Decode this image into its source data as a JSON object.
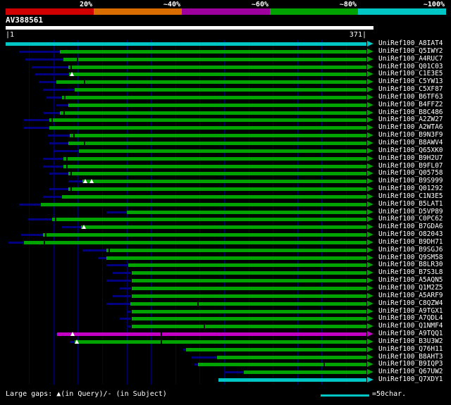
{
  "colors": {
    "green": "#00a300",
    "cyan": "#00c6c6",
    "magenta": "#c400c4",
    "navy": "#000080",
    "tick": "#001400",
    "grid": "#00005e",
    "query_bar": "#ffffff"
  },
  "chart_data": {
    "type": "alignment-overview",
    "title": "AV388561",
    "query": {
      "name": "AV388561",
      "length": 371,
      "start_label": "|1",
      "end_label": "371|"
    },
    "color_key": {
      "segments": [
        {
          "label": "20%",
          "color": "#d10000"
        },
        {
          "label": "~40%",
          "color": "#d96d00"
        },
        {
          "label": "~60%",
          "color": "#9d009d"
        },
        {
          "label": "~80%",
          "color": "#00a300"
        },
        {
          "label": "~100%",
          "color": "#00c6c6"
        }
      ]
    },
    "legend": {
      "gaps_text": "Large gaps: ▲(in Query)/- (in Subject)",
      "scale_text": "=50char.",
      "scale_chars": 50
    },
    "alignments": [
      {
        "label": "UniRef100_A8IAT4",
        "color": "cyan",
        "subject_start": 1,
        "align_start": 1,
        "align_end": 371,
        "ticks": [],
        "gaps": []
      },
      {
        "label": "UniRef100_Q5IWY2",
        "color": "green",
        "subject_start": 15,
        "align_start": 57,
        "align_end": 371,
        "ticks": [],
        "gaps": []
      },
      {
        "label": "UniRef100_A4RUC7",
        "color": "green",
        "subject_start": 21,
        "align_start": 60,
        "align_end": 371,
        "ticks": [
          75
        ],
        "gaps": []
      },
      {
        "label": "UniRef100_Q01C03",
        "color": "green",
        "subject_start": 28,
        "align_start": 65,
        "align_end": 371,
        "ticks": [
          68
        ],
        "gaps": []
      },
      {
        "label": "UniRef100_C1E3E5",
        "color": "green",
        "subject_start": 31,
        "align_start": 66,
        "align_end": 371,
        "ticks": [],
        "gaps": [
          69
        ]
      },
      {
        "label": "UniRef100_C5YW13",
        "color": "green",
        "subject_start": 35,
        "align_start": 53,
        "align_end": 371,
        "ticks": [
          82
        ],
        "gaps": []
      },
      {
        "label": "UniRef100_C5XF87",
        "color": "green",
        "subject_start": 39,
        "align_start": 72,
        "align_end": 371,
        "ticks": [],
        "gaps": []
      },
      {
        "label": "UniRef100_B6TF63",
        "color": "green",
        "subject_start": 43,
        "align_start": 59,
        "align_end": 371,
        "ticks": [
          62
        ],
        "gaps": []
      },
      {
        "label": "UniRef100_B4FFZ2",
        "color": "green",
        "subject_start": 53,
        "align_start": 65,
        "align_end": 371,
        "ticks": [],
        "gaps": []
      },
      {
        "label": "UniRef100_B8C486",
        "color": "green",
        "subject_start": 40,
        "align_start": 57,
        "align_end": 371,
        "ticks": [
          61
        ],
        "gaps": []
      },
      {
        "label": "UniRef100_A2ZW27",
        "color": "green",
        "subject_start": 20,
        "align_start": 46,
        "align_end": 371,
        "ticks": [
          49
        ],
        "gaps": []
      },
      {
        "label": "UniRef100_A2WTA6",
        "color": "green",
        "subject_start": 20,
        "align_start": 46,
        "align_end": 371,
        "ticks": [],
        "gaps": []
      },
      {
        "label": "UniRef100_B9N3F9",
        "color": "green",
        "subject_start": 44,
        "align_start": 67,
        "align_end": 371,
        "ticks": [
          71
        ],
        "gaps": []
      },
      {
        "label": "UniRef100_B8AWV4",
        "color": "green",
        "subject_start": 46,
        "align_start": 65,
        "align_end": 371,
        "ticks": [
          82
        ],
        "gaps": []
      },
      {
        "label": "UniRef100_Q65XK0",
        "color": "green",
        "subject_start": 50,
        "align_start": 76,
        "align_end": 371,
        "ticks": [],
        "gaps": []
      },
      {
        "label": "UniRef100_B9H2U7",
        "color": "green",
        "subject_start": 39,
        "align_start": 60,
        "align_end": 371,
        "ticks": [
          64
        ],
        "gaps": []
      },
      {
        "label": "UniRef100_B9FL07",
        "color": "green",
        "subject_start": 39,
        "align_start": 60,
        "align_end": 371,
        "ticks": [
          64
        ],
        "gaps": []
      },
      {
        "label": "UniRef100_Q05758",
        "color": "green",
        "subject_start": 46,
        "align_start": 65,
        "align_end": 371,
        "ticks": [
          68
        ],
        "gaps": []
      },
      {
        "label": "UniRef100_B9S999",
        "color": "green",
        "subject_start": 65,
        "align_start": 80,
        "align_end": 371,
        "ticks": [],
        "gaps": [
          83,
          89
        ]
      },
      {
        "label": "UniRef100_Q01292",
        "color": "green",
        "subject_start": 46,
        "align_start": 65,
        "align_end": 371,
        "ticks": [
          68
        ],
        "gaps": []
      },
      {
        "label": "UniRef100_C1N3E5",
        "color": "green",
        "subject_start": 39,
        "align_start": 59,
        "align_end": 371,
        "ticks": [],
        "gaps": []
      },
      {
        "label": "UniRef100_B5LAT1",
        "color": "green",
        "subject_start": 15,
        "align_start": 37,
        "align_end": 371,
        "ticks": [],
        "gaps": []
      },
      {
        "label": "UniRef100_D5VP89",
        "color": "green",
        "subject_start": 104,
        "align_start": 125,
        "align_end": 371,
        "ticks": [],
        "gaps": []
      },
      {
        "label": "UniRef100_C0PC62",
        "color": "green",
        "subject_start": 24,
        "align_start": 49,
        "align_end": 371,
        "ticks": [
          52
        ],
        "gaps": []
      },
      {
        "label": "UniRef100_B7GDA6",
        "color": "green",
        "subject_start": 59,
        "align_start": 78,
        "align_end": 371,
        "ticks": [],
        "gaps": [
          81
        ]
      },
      {
        "label": "UniRef100_O82043",
        "color": "green",
        "subject_start": 17,
        "align_start": 39,
        "align_end": 371,
        "ticks": [
          42
        ],
        "gaps": []
      },
      {
        "label": "UniRef100_B9DH71",
        "color": "green",
        "subject_start": 4,
        "align_start": 20,
        "align_end": 371,
        "ticks": [
          41
        ],
        "gaps": []
      },
      {
        "label": "UniRef100_B9SGJ6",
        "color": "green",
        "subject_start": 80,
        "align_start": 104,
        "align_end": 371,
        "ticks": [
          107
        ],
        "gaps": []
      },
      {
        "label": "UniRef100_Q9SM58",
        "color": "green",
        "subject_start": 96,
        "align_start": 104,
        "align_end": 371,
        "ticks": [],
        "gaps": []
      },
      {
        "label": "UniRef100_B8LR30",
        "color": "green",
        "subject_start": 104,
        "align_start": 127,
        "align_end": 371,
        "ticks": [],
        "gaps": []
      },
      {
        "label": "UniRef100_B7S3L8",
        "color": "green",
        "subject_start": 111,
        "align_start": 130,
        "align_end": 371,
        "ticks": [],
        "gaps": []
      },
      {
        "label": "UniRef100_A5AQN5",
        "color": "green",
        "subject_start": 104,
        "align_start": 130,
        "align_end": 371,
        "ticks": [],
        "gaps": []
      },
      {
        "label": "UniRef100_Q1M2Z5",
        "color": "green",
        "subject_start": 118,
        "align_start": 130,
        "align_end": 371,
        "ticks": [],
        "gaps": []
      },
      {
        "label": "UniRef100_A5ARF9",
        "color": "green",
        "subject_start": 111,
        "align_start": 130,
        "align_end": 371,
        "ticks": [],
        "gaps": []
      },
      {
        "label": "UniRef100_C8QZW4",
        "color": "green",
        "subject_start": 104,
        "align_start": 129,
        "align_end": 371,
        "ticks": [
          198
        ],
        "gaps": []
      },
      {
        "label": "UniRef100_A9TGX1",
        "color": "green",
        "subject_start": 125,
        "align_start": 130,
        "align_end": 371,
        "ticks": [],
        "gaps": []
      },
      {
        "label": "UniRef100_A7QDL4",
        "color": "green",
        "subject_start": 118,
        "align_start": 130,
        "align_end": 371,
        "ticks": [],
        "gaps": []
      },
      {
        "label": "UniRef100_Q1NMF4",
        "color": "green",
        "subject_start": 127,
        "align_start": 130,
        "align_end": 371,
        "ticks": [
          205
        ],
        "gaps": []
      },
      {
        "label": "UniRef100_A9TQQ1",
        "color": "magenta",
        "subject_start": 52,
        "align_start": 54,
        "align_end": 371,
        "ticks": [
          161
        ],
        "gaps": [
          70
        ]
      },
      {
        "label": "UniRef100_B3U3W2",
        "color": "green",
        "subject_start": 67,
        "align_start": 72,
        "align_end": 371,
        "ticks": [
          161
        ],
        "gaps": [
          74
        ]
      },
      {
        "label": "UniRef100_Q76H11",
        "color": "green",
        "subject_start": 183,
        "align_start": 186,
        "align_end": 371,
        "ticks": [],
        "gaps": []
      },
      {
        "label": "UniRef100_B8AHT3",
        "color": "green",
        "subject_start": 192,
        "align_start": 218,
        "align_end": 371,
        "ticks": [],
        "gaps": []
      },
      {
        "label": "UniRef100_B9IQP3",
        "color": "green",
        "subject_start": 195,
        "align_start": 198,
        "align_end": 371,
        "ticks": [
          328
        ],
        "gaps": []
      },
      {
        "label": "UniRef100_Q67UW2",
        "color": "green",
        "subject_start": 226,
        "align_start": 245,
        "align_end": 371,
        "ticks": [],
        "gaps": []
      },
      {
        "label": "UniRef100_Q7XDY1",
        "color": "cyan",
        "subject_start": 219,
        "align_start": 219,
        "align_end": 371,
        "ticks": [],
        "gaps": []
      }
    ]
  }
}
